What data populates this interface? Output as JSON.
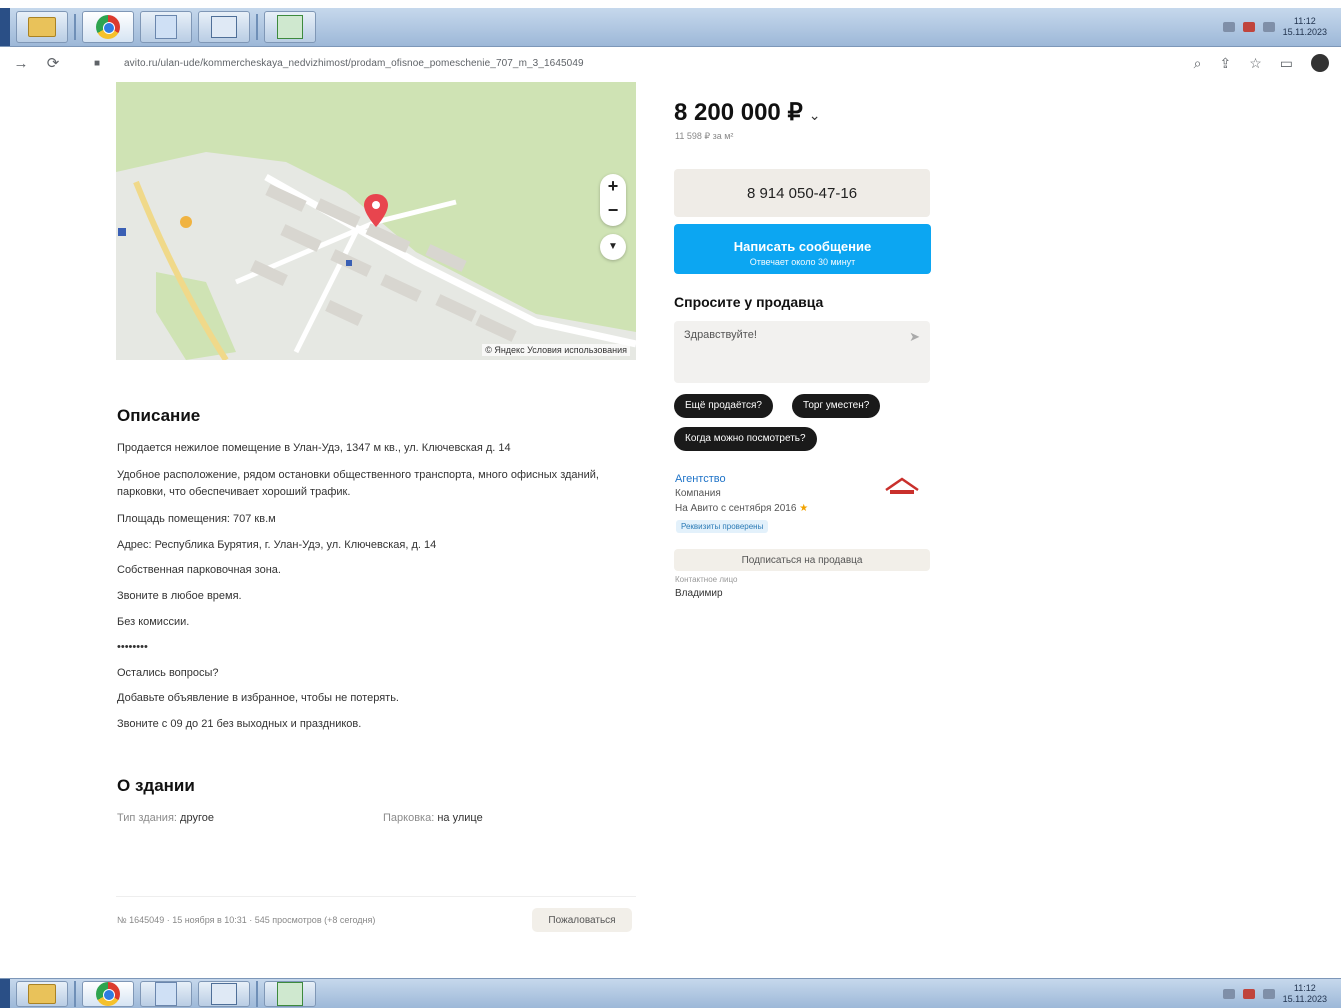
{
  "browser": {
    "url": "avito.ru/ulan-ude/kommercheskaya_nedvizhimost/prodam_ofisnoe_pomeschenie_707_m_3_1645049",
    "icons": [
      "back-arrow-icon",
      "reload-icon",
      "lock-icon",
      "zoom-icon",
      "share-icon",
      "star-icon",
      "sidebar-icon",
      "profile-avatar"
    ]
  },
  "map": {
    "copyright": "© Яндекс Условия использования",
    "zoom_in": "+",
    "zoom_out": "−",
    "geo": "▼",
    "colors": {
      "park": "#cfe3b4",
      "land": "#e6e8e3",
      "road": "#ffffff",
      "building": "#d8d6d0",
      "pin": "#e8454e"
    }
  },
  "description": {
    "title": "Описание",
    "lines": [
      "Продается нежилое помещение в Улан-Удэ, 1347 м кв., ул. Ключевская д. 14",
      "Удобное расположение, рядом остановки общественного транспорта, много офисных зданий,",
      "парковки, что обеспечивает хороший трафик.",
      "Площадь помещения: 707 кв.м",
      "Адрес: Республика Бурятия, г. Улан-Удэ, ул. Ключевская, д. 14",
      "Собственная парковочная зона.",
      "Звоните в любое время.",
      "Без комиссии.",
      "••••••••",
      "Остались вопросы?",
      "Добавьте объявление в избранное, чтобы не потерять.",
      "Звоните с 09 до 21 без выходных и праздников."
    ]
  },
  "building": {
    "title": "О здании",
    "items": [
      {
        "key": "Тип здания:",
        "value": "другое"
      },
      {
        "key": "Парковка:",
        "value": "на улице"
      }
    ]
  },
  "footer": {
    "text": "№ 1645049 · 15 ноября в 10:31 · 545 просмотров (+8 сегодня)",
    "complain": "Пожаловаться"
  },
  "listing": {
    "price": "8 200 000 ₽",
    "price_chevron": "⌄",
    "price_per_m": "11 598 ₽ за м²",
    "phone": "8 914 050-47-16",
    "message_title": "Написать сообщение",
    "message_sub": "Отвечает около 30 минут",
    "ask_title": "Спросите у продавца",
    "ask_placeholder": "Здравствуйте!",
    "ask_send": "➤",
    "chips": [
      "Ещё продаётся?",
      "Торг уместен?",
      "Когда можно посмотреть?"
    ],
    "accent_color": "#0ca6f2"
  },
  "seller": {
    "name": "Агентство",
    "type": "Компания",
    "since": "На Авито с сентября 2016",
    "rating_star": "★",
    "badge": "Реквизиты проверены",
    "subscribe": "Подписаться на продавца",
    "contact_label": "Контактное лицо",
    "contact_name": "Владимир"
  },
  "taskbar": {
    "clock_top": [
      "11:12",
      "15.11.2023"
    ],
    "clock_bottom": [
      "11:12",
      "15.11.2023"
    ],
    "buttons": [
      "folder-icon",
      "chrome-icon",
      "document-icon",
      "image-icon",
      "spreadsheet-icon"
    ]
  }
}
